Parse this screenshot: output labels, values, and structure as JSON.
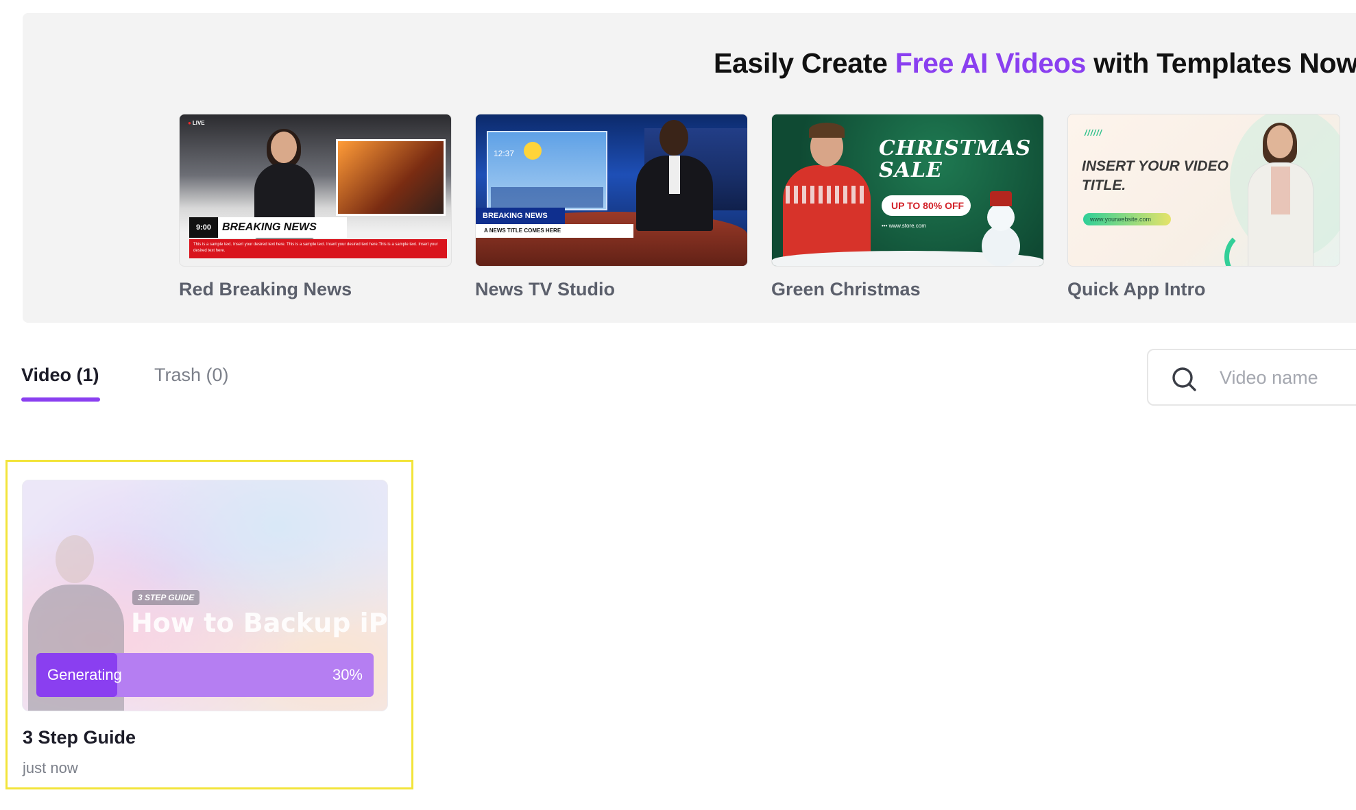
{
  "banner": {
    "title_before": "Easily Create ",
    "title_highlight": "Free AI Videos",
    "title_after": " with Templates Now!",
    "accent_color": "#8a3ff0",
    "templates": [
      {
        "name": "Red Breaking News",
        "thumb": {
          "live": "LIVE",
          "clock": "9:00",
          "headline": "BREAKING NEWS",
          "ticker": "This is a sample text. Insert your desired text here. This is a sample text. Insert your desired text here.This is a sample text. Insert your desired text here."
        }
      },
      {
        "name": "News TV Studio",
        "thumb": {
          "time": "12:37",
          "headline": "BREAKING NEWS",
          "subtitle": "A NEWS TITLE COMES HERE"
        }
      },
      {
        "name": "Green Christmas",
        "thumb": {
          "title": "CHRISTMAS SALE",
          "offer": "UP TO 80% OFF",
          "url": "••• www.store.com"
        }
      },
      {
        "name": "Quick App Intro",
        "thumb": {
          "ticks": "//////",
          "title": "INSERT YOUR VIDEO TITLE.",
          "url": "www.yourwebsite.com"
        }
      }
    ]
  },
  "tabs": {
    "video": "Video (1)",
    "trash": "Trash (0)",
    "active": "video"
  },
  "search": {
    "icon": "search-icon",
    "placeholder": "Video name",
    "value": ""
  },
  "videos": [
    {
      "title": "3 Step Guide",
      "time": "just now",
      "thumb": {
        "tag": "3 STEP GUIDE",
        "headline": "How to Backup iPad"
      },
      "status": "Generating",
      "progress_percent": 30,
      "progress_label": "30%"
    }
  ]
}
